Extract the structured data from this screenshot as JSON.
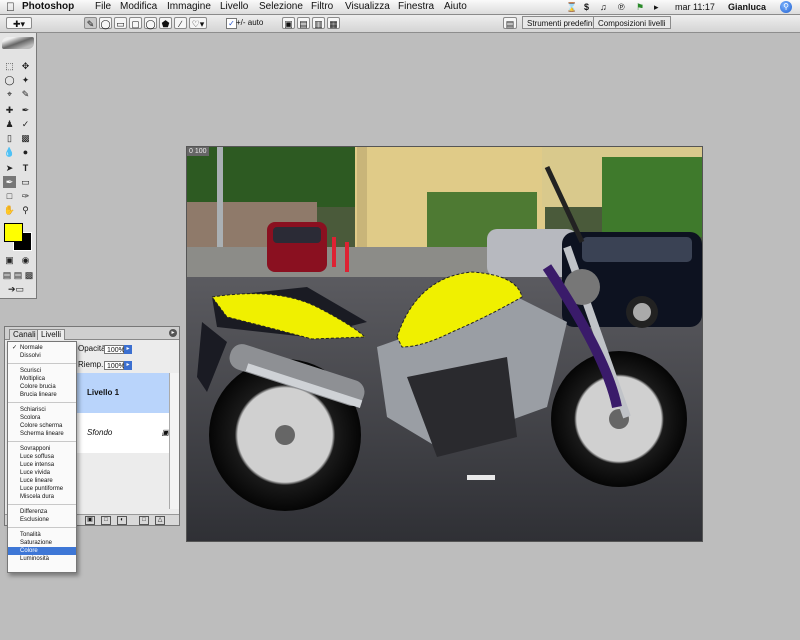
{
  "menubar": {
    "app": "Photoshop",
    "items": [
      "File",
      "Modifica",
      "Immagine",
      "Livello",
      "Selezione",
      "Filtro",
      "Visualizza",
      "Finestra",
      "Aiuto"
    ],
    "clock": "mar 11:17",
    "user": "Gianluca",
    "status_icons": [
      "hourglass-icon",
      "s-icon",
      "sound-icon",
      "volume-icon",
      "battery-icon",
      "flag-icon",
      "eject-icon"
    ]
  },
  "options": {
    "auto_label": "+/- auto",
    "well_tabs": [
      "Strumenti predefiniti",
      "Composizioni livelli"
    ]
  },
  "document": {
    "ruler_label": "0 100"
  },
  "layers_palette": {
    "tabs": [
      "Canali",
      "Livelli"
    ],
    "opacity_label": "Opacità:",
    "opacity_value": "100%",
    "fill_label": "Riemp.:",
    "fill_value": "100%",
    "layers": [
      {
        "name": "Livello 1",
        "selected": true
      },
      {
        "name": "Sfondo",
        "selected": false
      }
    ]
  },
  "blend_menu": {
    "selected": "Colore",
    "groups": [
      [
        "Normale",
        "Dissolvi"
      ],
      [
        "Scurisci",
        "Moltiplica",
        "Colore brucia",
        "Brucia lineare"
      ],
      [
        "Schiarisci",
        "Scolora",
        "Colore scherma",
        "Scherma lineare"
      ],
      [
        "Sovrapponi",
        "Luce soffusa",
        "Luce intensa",
        "Luce vivida",
        "Luce lineare",
        "Luce puntiforme",
        "Miscela dura"
      ],
      [
        "Differenza",
        "Esclusione"
      ],
      [
        "Tonalità",
        "Saturazione",
        "Colore",
        "Luminosità"
      ]
    ]
  },
  "colors": {
    "foreground": "#ffff00",
    "background": "#000000",
    "highlight": "#3e77d6"
  }
}
